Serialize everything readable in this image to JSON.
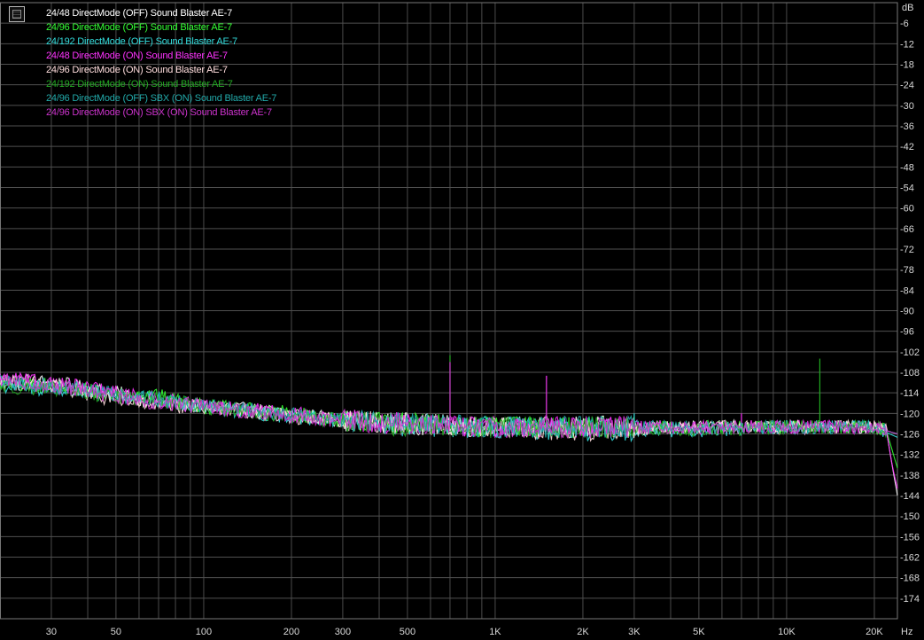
{
  "chart_data": {
    "type": "line",
    "y_unit": "dB",
    "x_unit": "Hz",
    "x_scale": "log",
    "xlim": [
      20,
      24000
    ],
    "ylim": [
      -180,
      0
    ],
    "grid": true,
    "legend_position": "top-left",
    "x_ticks": [
      {
        "v": 30,
        "label": "30"
      },
      {
        "v": 50,
        "label": "50"
      },
      {
        "v": 100,
        "label": "100"
      },
      {
        "v": 200,
        "label": "200"
      },
      {
        "v": 300,
        "label": "300"
      },
      {
        "v": 500,
        "label": "500"
      },
      {
        "v": 1000,
        "label": "1K"
      },
      {
        "v": 2000,
        "label": "2K"
      },
      {
        "v": 3000,
        "label": "3K"
      },
      {
        "v": 5000,
        "label": "5K"
      },
      {
        "v": 10000,
        "label": "10K"
      },
      {
        "v": 20000,
        "label": "20K"
      }
    ],
    "y_ticks": [
      -6,
      -12,
      -18,
      -24,
      -30,
      -36,
      -42,
      -48,
      -54,
      -60,
      -66,
      -72,
      -78,
      -84,
      -90,
      -96,
      -102,
      -108,
      -114,
      -120,
      -126,
      -132,
      -138,
      -144,
      -150,
      -156,
      -162,
      -168,
      -174
    ],
    "series": [
      {
        "name": "24/48 DirectMode (OFF) Sound Blaster AE-7",
        "color": "#ffffff",
        "points": [
          [
            20,
            -110
          ],
          [
            30,
            -111
          ],
          [
            50,
            -114
          ],
          [
            70,
            -117
          ],
          [
            100,
            -118
          ],
          [
            200,
            -120
          ],
          [
            300,
            -122
          ],
          [
            500,
            -123
          ],
          [
            1000,
            -124
          ],
          [
            2000,
            -124
          ],
          [
            5000,
            -124
          ],
          [
            10000,
            -124
          ],
          [
            20000,
            -124
          ],
          [
            22000,
            -125
          ],
          [
            23000,
            -135
          ],
          [
            24000,
            -144
          ]
        ],
        "spikes": []
      },
      {
        "name": "24/96 DirectMode (OFF) Sound Blaster AE-7",
        "color": "#33ff33",
        "points": [
          [
            20,
            -111
          ],
          [
            30,
            -112
          ],
          [
            50,
            -114
          ],
          [
            70,
            -115
          ],
          [
            100,
            -118
          ],
          [
            200,
            -120
          ],
          [
            300,
            -122
          ],
          [
            500,
            -123
          ],
          [
            1000,
            -124
          ],
          [
            2000,
            -124
          ],
          [
            5000,
            -124
          ],
          [
            10000,
            -124
          ],
          [
            20000,
            -124
          ],
          [
            22000,
            -125
          ],
          [
            24000,
            -136
          ]
        ],
        "spikes": []
      },
      {
        "name": "24/192 DirectMode (OFF) Sound Blaster AE-7",
        "color": "#33dddd",
        "points": [
          [
            20,
            -112
          ],
          [
            30,
            -113
          ],
          [
            50,
            -115
          ],
          [
            70,
            -116
          ],
          [
            100,
            -118
          ],
          [
            200,
            -121
          ],
          [
            300,
            -122
          ],
          [
            500,
            -124
          ],
          [
            1000,
            -124
          ],
          [
            2000,
            -125
          ],
          [
            5000,
            -125
          ],
          [
            10000,
            -124
          ],
          [
            20000,
            -124
          ],
          [
            24000,
            -127
          ]
        ],
        "spikes": [
          [
            3000,
            -120
          ],
          [
            10000,
            -122
          ]
        ]
      },
      {
        "name": "24/48 DirectMode (ON) Sound Blaster AE-7",
        "color": "#ff33ff",
        "points": [
          [
            20,
            -110
          ],
          [
            30,
            -111
          ],
          [
            50,
            -114
          ],
          [
            70,
            -116
          ],
          [
            100,
            -118
          ],
          [
            200,
            -120
          ],
          [
            300,
            -122
          ],
          [
            500,
            -123
          ],
          [
            1000,
            -124
          ],
          [
            2000,
            -124
          ],
          [
            5000,
            -124
          ],
          [
            10000,
            -124
          ],
          [
            20000,
            -124
          ],
          [
            22000,
            -125
          ],
          [
            23000,
            -135
          ],
          [
            24000,
            -142
          ]
        ],
        "spikes": [
          [
            1500,
            -109
          ],
          [
            7000,
            -120
          ]
        ]
      },
      {
        "name": "24/96 DirectMode (ON) Sound Blaster AE-7",
        "color": "#ffdddd",
        "points": [
          [
            20,
            -111
          ],
          [
            30,
            -112
          ],
          [
            50,
            -116
          ],
          [
            70,
            -118
          ],
          [
            100,
            -118
          ],
          [
            200,
            -121
          ],
          [
            300,
            -122
          ],
          [
            500,
            -123
          ],
          [
            1000,
            -124
          ],
          [
            2000,
            -125
          ],
          [
            5000,
            -124
          ],
          [
            10000,
            -124
          ],
          [
            20000,
            -124
          ],
          [
            24000,
            -126
          ]
        ],
        "spikes": []
      },
      {
        "name": "24/192 DirectMode (ON) Sound Blaster AE-7",
        "color": "#22aa22",
        "points": [
          [
            20,
            -112
          ],
          [
            30,
            -113
          ],
          [
            50,
            -115
          ],
          [
            70,
            -116
          ],
          [
            100,
            -118
          ],
          [
            200,
            -121
          ],
          [
            300,
            -122
          ],
          [
            500,
            -124
          ],
          [
            1000,
            -124
          ],
          [
            2000,
            -124
          ],
          [
            5000,
            -125
          ],
          [
            10000,
            -124
          ],
          [
            20000,
            -124
          ],
          [
            24000,
            -126
          ]
        ],
        "spikes": [
          [
            700,
            -103
          ],
          [
            13000,
            -104
          ]
        ]
      },
      {
        "name": "24/96 DirectMode (OFF) SBX (ON) Sound Blaster AE-7",
        "color": "#22aaaa",
        "points": [
          [
            20,
            -111
          ],
          [
            30,
            -112
          ],
          [
            50,
            -114
          ],
          [
            70,
            -116
          ],
          [
            100,
            -118
          ],
          [
            200,
            -120
          ],
          [
            300,
            -122
          ],
          [
            500,
            -123
          ],
          [
            1000,
            -124
          ],
          [
            2000,
            -124
          ],
          [
            5000,
            -124
          ],
          [
            10000,
            -124
          ],
          [
            20000,
            -124
          ],
          [
            24000,
            -126
          ]
        ],
        "spikes": []
      },
      {
        "name": "24/96 DirectMode (ON) SBX (ON) Sound Blaster AE-7",
        "color": "#cc33cc",
        "points": [
          [
            20,
            -110
          ],
          [
            30,
            -112
          ],
          [
            50,
            -115
          ],
          [
            70,
            -117
          ],
          [
            100,
            -118
          ],
          [
            200,
            -121
          ],
          [
            300,
            -122
          ],
          [
            500,
            -123
          ],
          [
            1000,
            -124
          ],
          [
            2000,
            -124
          ],
          [
            5000,
            -124
          ],
          [
            10000,
            -124
          ],
          [
            20000,
            -124
          ],
          [
            24000,
            -126
          ]
        ],
        "spikes": [
          [
            700,
            -105
          ],
          [
            1500,
            -110
          ]
        ]
      }
    ]
  }
}
